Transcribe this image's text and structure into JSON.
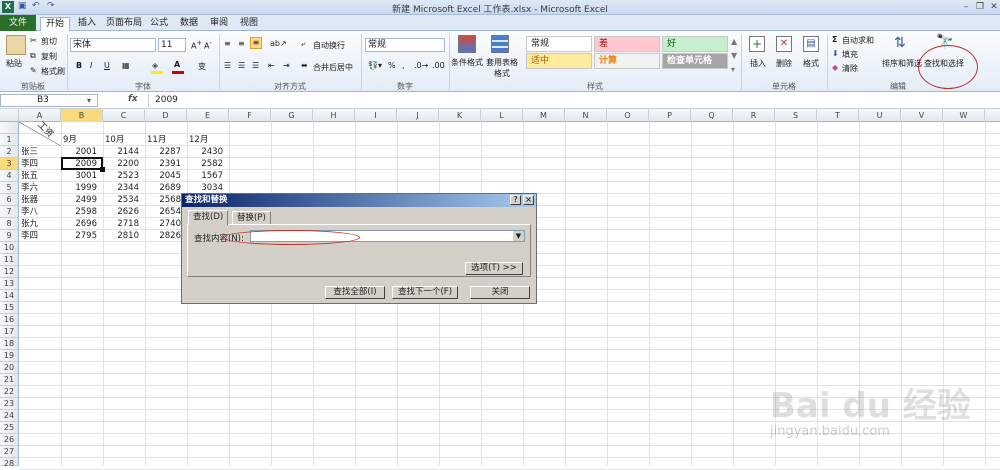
{
  "window": {
    "title": "新建 Microsoft Excel 工作表.xlsx - Microsoft Excel",
    "logo": "X"
  },
  "quick_access": {
    "icons": [
      "save-icon",
      "undo-icon",
      "redo-icon"
    ]
  },
  "tabs": [
    "文件",
    "开始",
    "插入",
    "页面布局",
    "公式",
    "数据",
    "审阅",
    "视图"
  ],
  "ribbon": {
    "clipboard": {
      "paste": "粘贴",
      "cut": "剪切",
      "copy": "复制",
      "format_painter": "格式刷",
      "label": "剪贴板"
    },
    "font": {
      "name": "宋体",
      "size": "11",
      "label": "字体"
    },
    "align": {
      "wrap": "自动换行",
      "merge": "合并后居中",
      "label": "对齐方式"
    },
    "number": {
      "format": "常规",
      "label": "数字"
    },
    "styles": {
      "cond": "条件格式",
      "table": "套用表格格式",
      "cells": [
        {
          "text": "常规",
          "bg": "#ffffff",
          "color": "#222222"
        },
        {
          "text": "差",
          "bg": "#ffc7ce",
          "color": "#9c0006"
        },
        {
          "text": "好",
          "bg": "#c6efce",
          "color": "#006100"
        },
        {
          "text": "适中",
          "bg": "#ffeb9c",
          "color": "#9c6500"
        },
        {
          "text": "计算",
          "bg": "#f2f2f2",
          "color": "#fa7d00"
        },
        {
          "text": "检查单元格",
          "bg": "#a5a5a5",
          "color": "#ffffff"
        }
      ],
      "label": "样式"
    },
    "cells": {
      "insert": "插入",
      "delete": "删除",
      "format": "格式",
      "label": "单元格"
    },
    "editing": {
      "autosum": "自动求和",
      "fill": "填充",
      "clear": "清除",
      "sort": "排序和筛选",
      "find": "查找和选择",
      "label": "编辑"
    }
  },
  "formula_bar": {
    "name_box": "B3",
    "fx": "fx",
    "content": "2009"
  },
  "columns": [
    "A",
    "B",
    "C",
    "D",
    "E",
    "F",
    "G",
    "H",
    "I",
    "J",
    "K",
    "L",
    "M",
    "N",
    "O",
    "P",
    "Q",
    "R",
    "S",
    "T",
    "U",
    "V",
    "W"
  ],
  "rows": [
    "1",
    "2",
    "3",
    "4",
    "5",
    "6",
    "7",
    "8",
    "9",
    "10",
    "11",
    "12",
    "13",
    "14",
    "15",
    "16",
    "17",
    "18",
    "19",
    "20",
    "21",
    "22",
    "23",
    "24",
    "25",
    "26",
    "27",
    "28"
  ],
  "sheet": {
    "a1": "工资",
    "headers": [
      "9月",
      "10月",
      "11月",
      "12月"
    ],
    "data": [
      {
        "name": "张三",
        "v": [
          "2001",
          "2144",
          "2287",
          "2430"
        ]
      },
      {
        "name": "李四",
        "v": [
          "2009",
          "2200",
          "2391",
          "2582"
        ]
      },
      {
        "name": "张五",
        "v": [
          "3001",
          "2523",
          "2045",
          "1567"
        ]
      },
      {
        "name": "李六",
        "v": [
          "1999",
          "2344",
          "2689",
          "3034"
        ]
      },
      {
        "name": "张器",
        "v": [
          "2499",
          "2534",
          "2568",
          ""
        ]
      },
      {
        "name": "李八",
        "v": [
          "2598",
          "2626",
          "2654",
          ""
        ]
      },
      {
        "name": "张九",
        "v": [
          "2696",
          "2718",
          "2740",
          ""
        ]
      },
      {
        "name": "李四",
        "v": [
          "2795",
          "2810",
          "2826",
          ""
        ]
      }
    ]
  },
  "dialog": {
    "title": "查找和替换",
    "help": "?",
    "close": "×",
    "tab_find": "查找(D)",
    "tab_replace": "替换(P)",
    "find_label": "查找内容(N):",
    "find_value": "",
    "options": "选项(T) >>",
    "find_all": "查找全部(I)",
    "find_next": "查找下一个(F)",
    "close_btn": "关闭"
  },
  "watermark": {
    "brand": "Bai du 经验",
    "url": "jingyan.baidu.com"
  }
}
